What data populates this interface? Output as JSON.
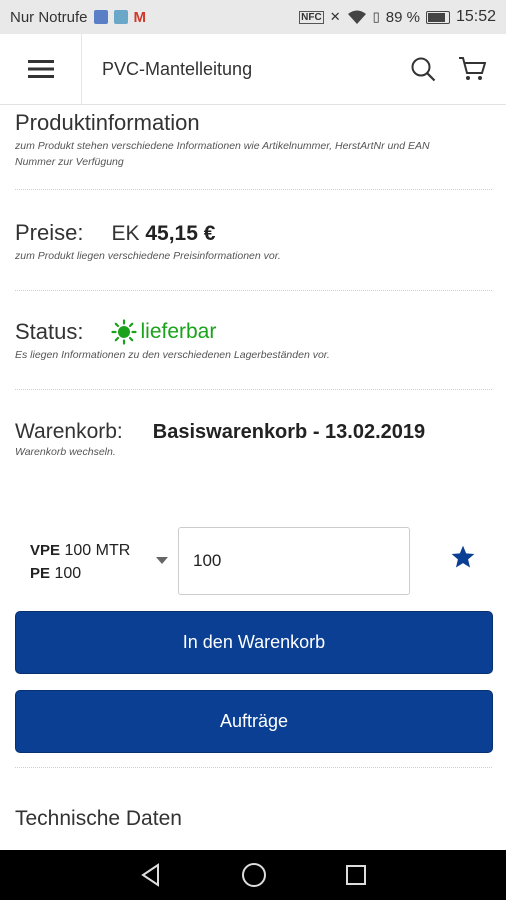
{
  "status_bar": {
    "carrier": "Nur Notrufe",
    "battery": "89 %",
    "time": "15:52"
  },
  "app_bar": {
    "title": "PVC-Mantelleitung"
  },
  "sections": {
    "produktinfo": {
      "title": "Produktinformation",
      "note": "zum Produkt stehen verschiedene Informationen wie Artikelnummer, HerstArtNr und EAN Nummer zur Verfügung"
    },
    "preise": {
      "label": "Preise:",
      "ek_prefix": "EK",
      "ek_value": "45,15 €",
      "note": "zum Produkt liegen verschiedene Preisinformationen vor."
    },
    "status": {
      "label": "Status:",
      "value": "lieferbar",
      "note": "Es liegen Informationen zu den verschiedenen Lagerbeständen vor."
    },
    "warenkorb": {
      "label": "Warenkorb:",
      "value": "Basiswarenkorb - 13.02.2019",
      "note": "Warenkorb wechseln."
    }
  },
  "quantity": {
    "vpe_label": "VPE",
    "vpe_value": "100 MTR",
    "pe_label": "PE",
    "pe_value": "100",
    "input_value": "100"
  },
  "buttons": {
    "add_to_cart": "In den Warenkorb",
    "orders": "Aufträge"
  },
  "technische_daten": {
    "title": "Technische Daten"
  },
  "colors": {
    "primary": "#0a3f93",
    "status_green": "#1aa31a"
  }
}
